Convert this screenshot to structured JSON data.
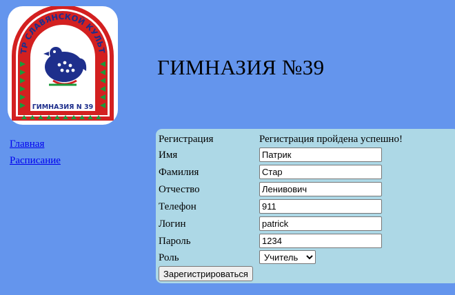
{
  "logo": {
    "ring_text": "ЦЕНТР СЛАВЯНСКОЙ КУЛЬТУРЫ",
    "bottom_text": "ГИМНАЗИЯ N 39",
    "colors": {
      "red": "#d32020",
      "green": "#1a9a3a",
      "blue": "#1e2f8c",
      "background": "#ffffff"
    }
  },
  "header": {
    "title": "ГИМНАЗИЯ №39"
  },
  "nav": {
    "items": [
      {
        "label": "Главная"
      },
      {
        "label": "Расписание"
      }
    ]
  },
  "form": {
    "heading": "Регистрация",
    "status": "Регистрация пройдена успешно!",
    "fields": [
      {
        "label": "Имя",
        "value": "Патрик"
      },
      {
        "label": "Фамилия",
        "value": "Стар"
      },
      {
        "label": "Отчество",
        "value": "Ленивович"
      },
      {
        "label": "Телефон",
        "value": "911"
      },
      {
        "label": "Логин",
        "value": "patrick"
      },
      {
        "label": "Пароль",
        "value": "1234"
      }
    ],
    "role": {
      "label": "Роль",
      "selected": "Учитель",
      "options": [
        "Учитель"
      ]
    },
    "submit_label": "Зарегистрироваться"
  },
  "colors": {
    "page_bg": "#6495ed",
    "panel_bg": "#add8e6",
    "link": "#0000ee"
  }
}
